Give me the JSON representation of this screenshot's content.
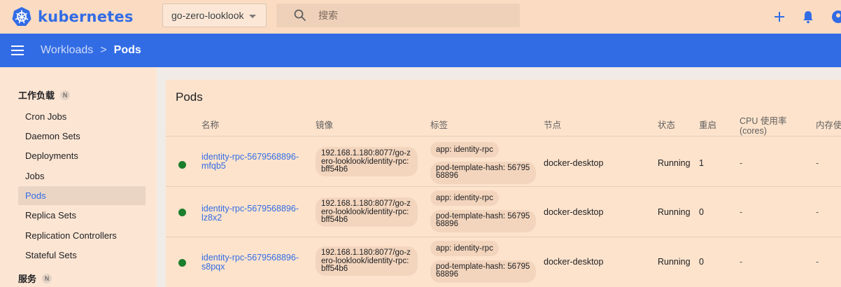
{
  "topbar": {
    "brand": "kubernetes",
    "namespace": "go-zero-looklook",
    "search_placeholder": "搜索"
  },
  "breadcrumb": {
    "parent": "Workloads",
    "separator": ">",
    "current": "Pods"
  },
  "sidebar": {
    "section_workloads": "工作负载",
    "section_workloads_badge": "N",
    "items": [
      {
        "label": "Cron Jobs"
      },
      {
        "label": "Daemon Sets"
      },
      {
        "label": "Deployments"
      },
      {
        "label": "Jobs"
      },
      {
        "label": "Pods"
      },
      {
        "label": "Replica Sets"
      },
      {
        "label": "Replication Controllers"
      },
      {
        "label": "Stateful Sets"
      }
    ],
    "section_services": "服务",
    "section_services_badge": "N"
  },
  "card": {
    "title": "Pods",
    "columns": {
      "name": "名称",
      "image": "镜像",
      "labels": "标签",
      "node": "节点",
      "status": "状态",
      "restarts": "重启",
      "cpu_line1": "CPU 使用率",
      "cpu_line2": "(cores)",
      "memory": "内存使"
    },
    "rows": [
      {
        "name": "identity-rpc-5679568896-mfqb5",
        "image": "192.168.1.180:8077/go-zero-looklook/identity-rpc:bff54b6",
        "label_app": "app: identity-rpc",
        "label_hash": "pod-template-hash: 5679568896",
        "node": "docker-desktop",
        "status": "Running",
        "restarts": "1",
        "cpu": "-",
        "memory": "-"
      },
      {
        "name": "identity-rpc-5679568896-lz8x2",
        "image": "192.168.1.180:8077/go-zero-looklook/identity-rpc:bff54b6",
        "label_app": "app: identity-rpc",
        "label_hash": "pod-template-hash: 5679568896",
        "node": "docker-desktop",
        "status": "Running",
        "restarts": "0",
        "cpu": "-",
        "memory": "-"
      },
      {
        "name": "identity-rpc-5679568896-s8pqx",
        "image": "192.168.1.180:8077/go-zero-looklook/identity-rpc:bff54b6",
        "label_app": "app: identity-rpc",
        "label_hash": "pod-template-hash: 5679568896",
        "node": "docker-desktop",
        "status": "Running",
        "restarts": "0",
        "cpu": "-",
        "memory": "-"
      }
    ]
  },
  "colors": {
    "accent": "#326ce5",
    "running": "#1b7e2c",
    "topbar_bg": "#fbdcc3"
  }
}
